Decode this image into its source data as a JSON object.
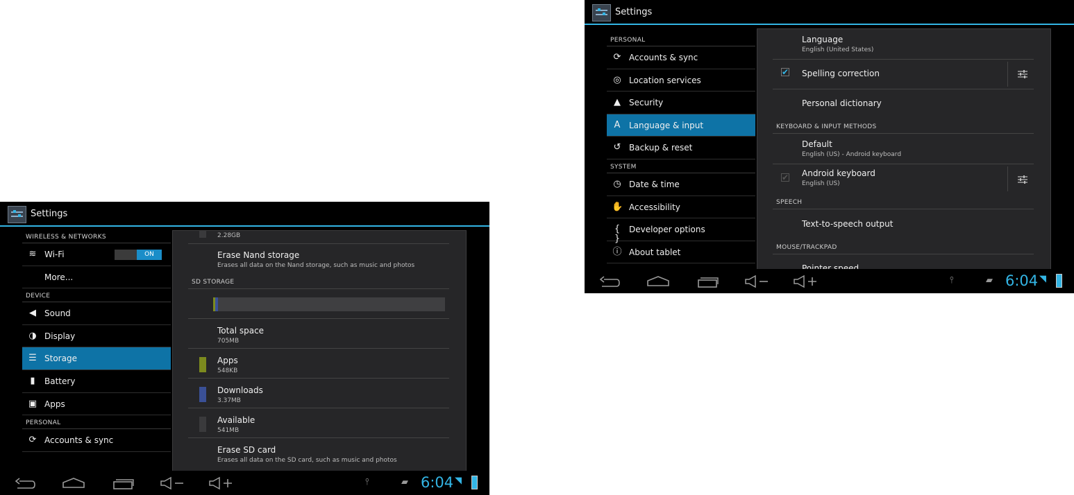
{
  "screen_a": {
    "title": "Settings",
    "sidebar": [
      {
        "type": "header",
        "label": "WIRELESS & NETWORKS"
      },
      {
        "type": "item",
        "label": "Wi-Fi",
        "icon": "wifi-icon",
        "toggle": "ON"
      },
      {
        "type": "item",
        "label": "More..."
      },
      {
        "type": "header",
        "label": "DEVICE"
      },
      {
        "type": "item",
        "label": "Sound",
        "icon": "volume-icon"
      },
      {
        "type": "item",
        "label": "Display",
        "icon": "brightness-icon"
      },
      {
        "type": "item",
        "label": "Storage",
        "icon": "storage-icon",
        "selected": true
      },
      {
        "type": "item",
        "label": "Battery",
        "icon": "battery-icon"
      },
      {
        "type": "item",
        "label": "Apps",
        "icon": "apps-icon"
      },
      {
        "type": "header",
        "label": "PERSONAL"
      },
      {
        "type": "item",
        "label": "Accounts & sync",
        "icon": "sync-icon"
      }
    ],
    "detail": {
      "top_value": "2.28GB",
      "erase_nand_title": "Erase Nand storage",
      "erase_nand_sub": "Erases all data on the Nand storage, such as music and photos",
      "sd_header": "SD STORAGE",
      "usage_bar": {
        "apps_fraction": 0.001,
        "downloads_fraction": 0.005
      },
      "rows": [
        {
          "title": "Total space",
          "sub": "705MB",
          "color": ""
        },
        {
          "title": "Apps",
          "sub": "548KB",
          "color": "#7c8a1e"
        },
        {
          "title": "Downloads",
          "sub": "3.37MB",
          "color": "#3a5096"
        },
        {
          "title": "Available",
          "sub": "541MB",
          "color": "#3a3a3c"
        }
      ],
      "erase_sd_title": "Erase SD card",
      "erase_sd_sub": "Erases all data on the SD card, such as music and photos"
    },
    "clock": "6:04"
  },
  "screen_b": {
    "title": "Settings",
    "sidebar": [
      {
        "type": "header",
        "label": "PERSONAL"
      },
      {
        "type": "item",
        "label": "Accounts & sync",
        "icon": "sync-icon"
      },
      {
        "type": "item",
        "label": "Location services",
        "icon": "location-icon"
      },
      {
        "type": "item",
        "label": "Security",
        "icon": "lock-icon"
      },
      {
        "type": "item",
        "label": "Language & input",
        "icon": "language-icon",
        "selected": true
      },
      {
        "type": "item",
        "label": "Backup & reset",
        "icon": "backup-icon"
      },
      {
        "type": "header",
        "label": "SYSTEM"
      },
      {
        "type": "item",
        "label": "Date & time",
        "icon": "clock-icon"
      },
      {
        "type": "item",
        "label": "Accessibility",
        "icon": "hand-icon"
      },
      {
        "type": "item",
        "label": "Developer options",
        "icon": "braces-icon"
      },
      {
        "type": "item",
        "label": "About tablet",
        "icon": "info-icon"
      }
    ],
    "detail": {
      "language_title": "Language",
      "language_sub": "English (United States)",
      "spelling": "Spelling correction",
      "dictionary": "Personal dictionary",
      "kb_header": "KEYBOARD & INPUT METHODS",
      "default_title": "Default",
      "default_sub": "English (US) - Android keyboard",
      "android_kb_title": "Android keyboard",
      "android_kb_sub": "English (US)",
      "speech_header": "SPEECH",
      "tts": "Text-to-speech output",
      "mouse_header": "MOUSE/TRACKPAD",
      "pointer": "Pointer speed"
    },
    "clock": "6:04"
  },
  "colors": {
    "accent": "#33b5e5",
    "selected": "#0e73a6",
    "panel": "#262628"
  }
}
